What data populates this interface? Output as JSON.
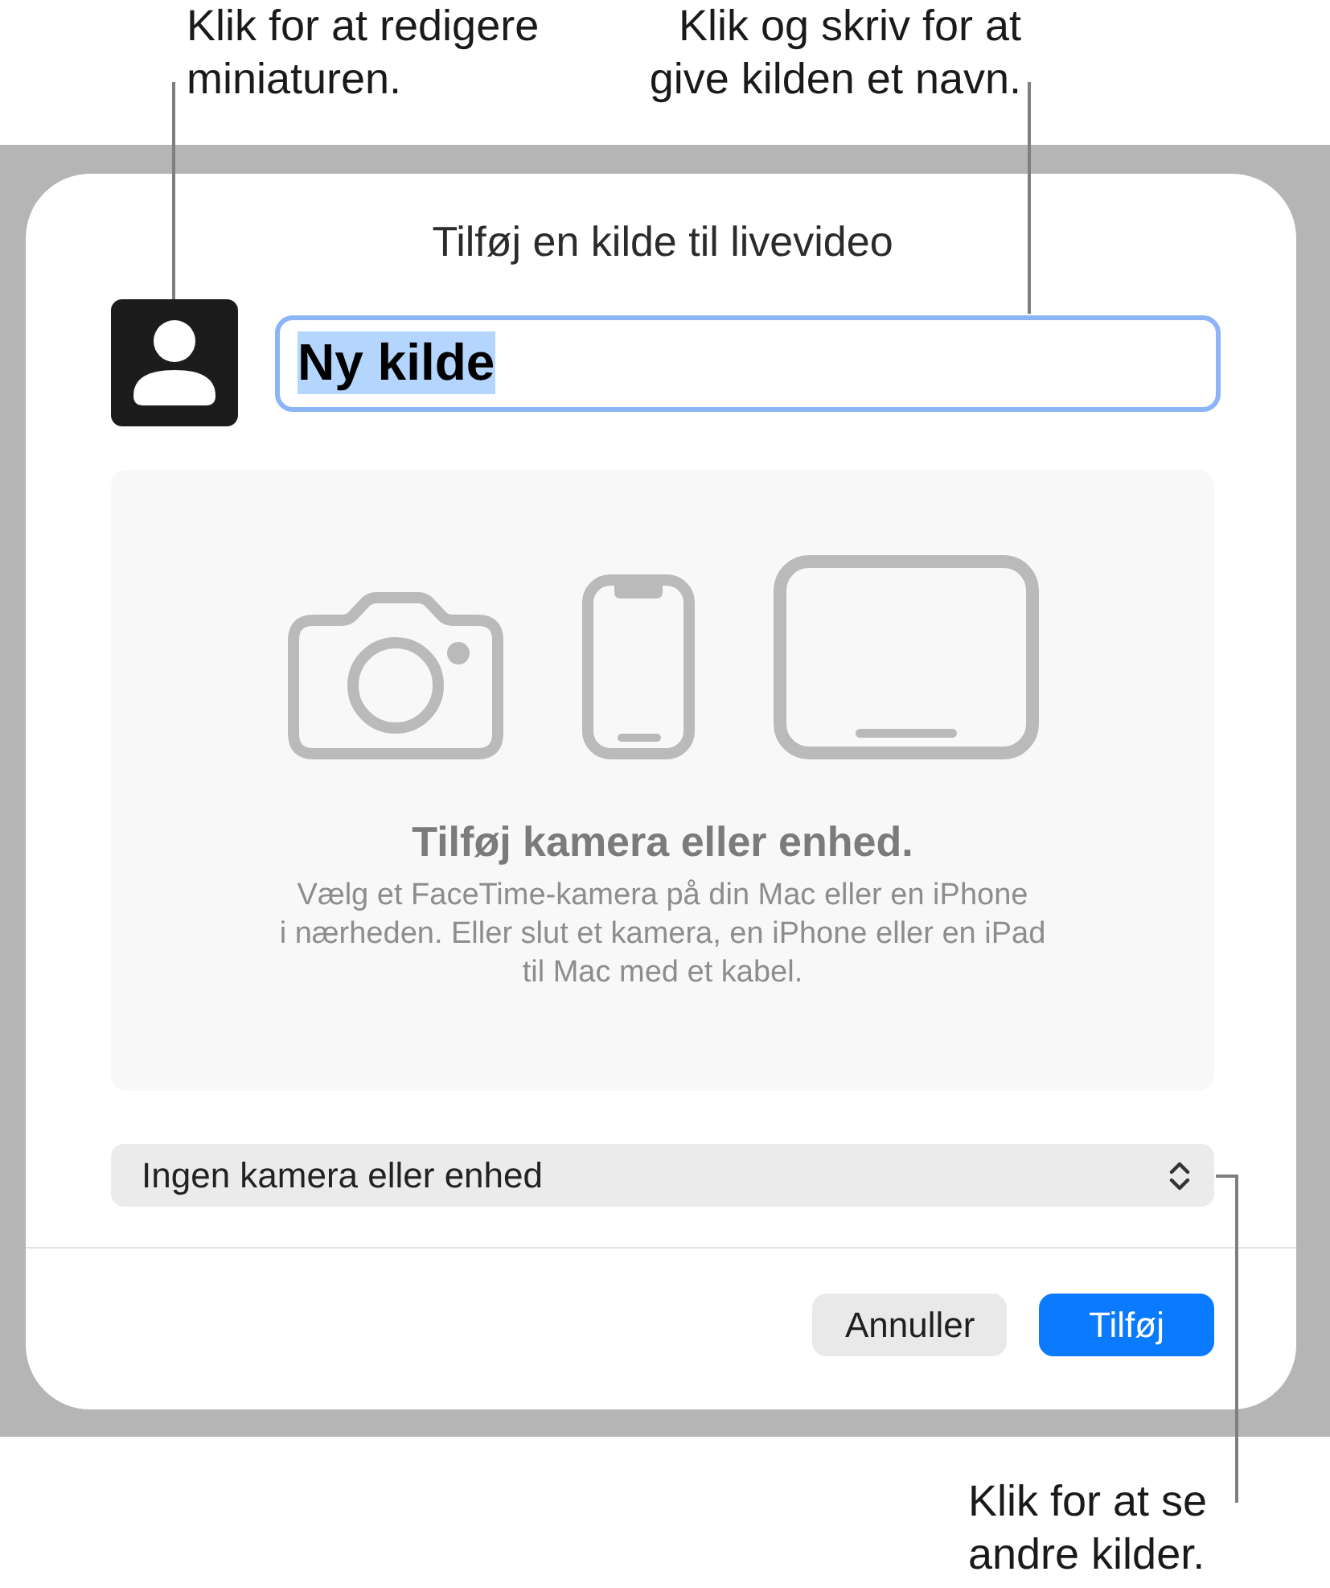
{
  "top_callouts": [
    {
      "lines": [
        "Klik for at redigere",
        "miniaturen."
      ]
    },
    {
      "lines": [
        "Klik og skriv for at",
        "give kilden et navn."
      ]
    }
  ],
  "dialog": {
    "title": "Tilføj en kilde til livevideo",
    "name_field": {
      "value": "Ny kilde",
      "focused": true,
      "text_selected": true
    },
    "drop_area": {
      "devices": [
        {
          "kind": "camera"
        },
        {
          "kind": "phone"
        },
        {
          "kind": "tablet"
        }
      ],
      "heading": "Tilføj kamera eller enhed.",
      "description_lines": [
        "Vælg et FaceTime-kamera på din Mac eller en iPhone",
        "i nærheden. Eller slut et kamera, en iPhone eller en iPad",
        "til Mac med et kabel."
      ]
    },
    "source_popup": {
      "value": "Ingen kamera eller enhed"
    },
    "buttons": [
      {
        "label": "Annuller",
        "kind": "secondary"
      },
      {
        "label": "Tilføj",
        "kind": "primary"
      }
    ]
  },
  "bottom_callout": {
    "lines": [
      "Klik for at se",
      "andre kilder."
    ]
  }
}
